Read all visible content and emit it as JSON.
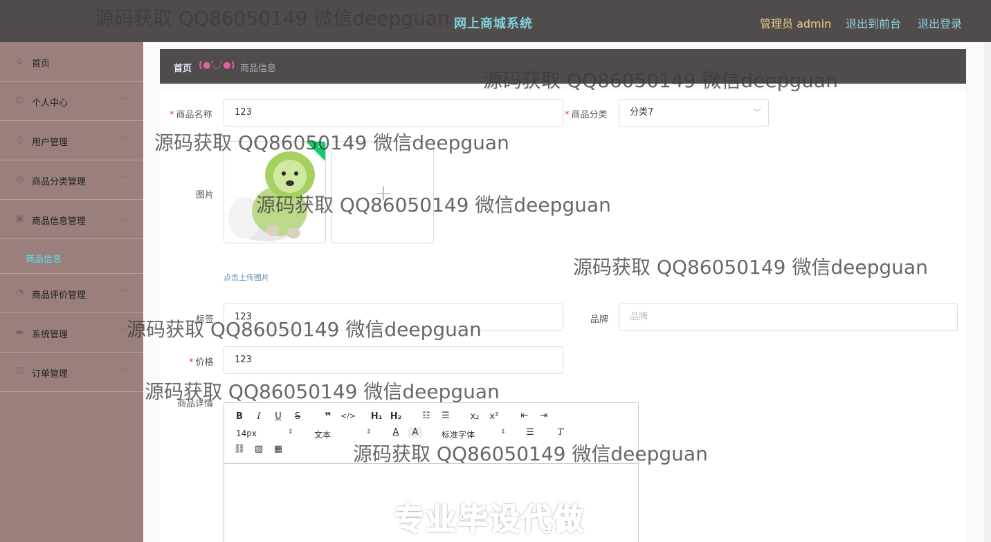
{
  "header": {
    "app_title": "网上商城系统",
    "user_label": "管理员 admin",
    "to_front": "退出到前台",
    "logout": "退出登录"
  },
  "sidebar": {
    "items": [
      {
        "label": "首页",
        "icon": "home-icon"
      },
      {
        "label": "个人中心",
        "icon": "user-icon"
      },
      {
        "label": "用户管理",
        "icon": "users-icon"
      },
      {
        "label": "商品分类管理",
        "icon": "category-icon"
      },
      {
        "label": "商品信息管理",
        "icon": "goods-icon"
      },
      {
        "label": "商品评价管理",
        "icon": "comment-icon"
      },
      {
        "label": "系统管理",
        "icon": "system-icon"
      },
      {
        "label": "订单管理",
        "icon": "order-icon"
      }
    ],
    "submenu_active": "商品信息"
  },
  "breadcrumb": {
    "home": "首页",
    "separator": "(●'◡'●)",
    "current": "商品信息"
  },
  "form": {
    "name_label": "商品名称",
    "name_value": "123",
    "category_label": "商品分类",
    "category_value": "分类7",
    "image_label": "图片",
    "upload_hint": "点击上传图片",
    "tag_label": "标签",
    "tag_value": "123",
    "brand_label": "品牌",
    "brand_placeholder": "品牌",
    "price_label": "价格",
    "price_value": "123",
    "detail_label": "商品详情"
  },
  "editor": {
    "font_size": "14px",
    "text_style": "文本",
    "font_family": "标准字体",
    "content_banner": "专业毕设代做"
  },
  "watermark_text": "源码获取 QQ86050149 微信deepguan"
}
